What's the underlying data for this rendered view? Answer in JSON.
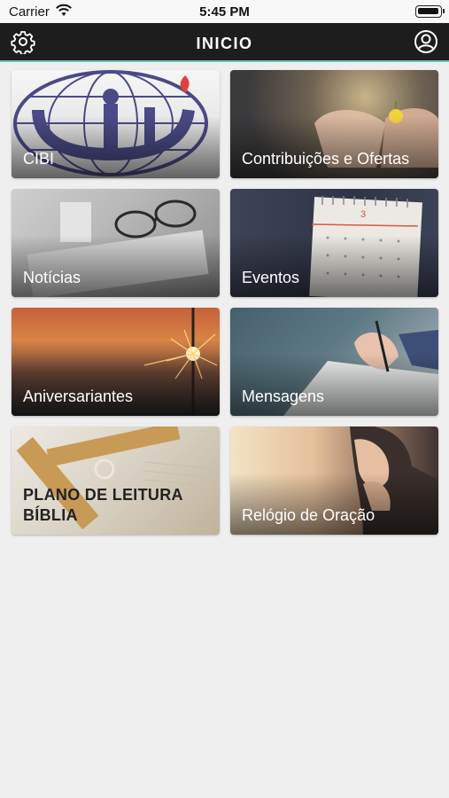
{
  "status": {
    "carrier": "Carrier",
    "time": "5:45 PM"
  },
  "header": {
    "title": "INICIO"
  },
  "tiles": [
    {
      "label": "CIBI"
    },
    {
      "label": "Contribuições e Ofertas"
    },
    {
      "label": "Notícias"
    },
    {
      "label": "Eventos"
    },
    {
      "label": "Aniversariantes"
    },
    {
      "label": "Mensagens"
    },
    {
      "label": "PLANO DE LEITURA BÍBLIA"
    },
    {
      "label": "Relógio de Oração"
    }
  ],
  "calendar_day": "3",
  "colors": {
    "app_bar": "#1d1d1d",
    "accent": "#6fc3b5",
    "background": "#efefef",
    "logo": "#4b4a86",
    "flame": "#e0433b"
  }
}
